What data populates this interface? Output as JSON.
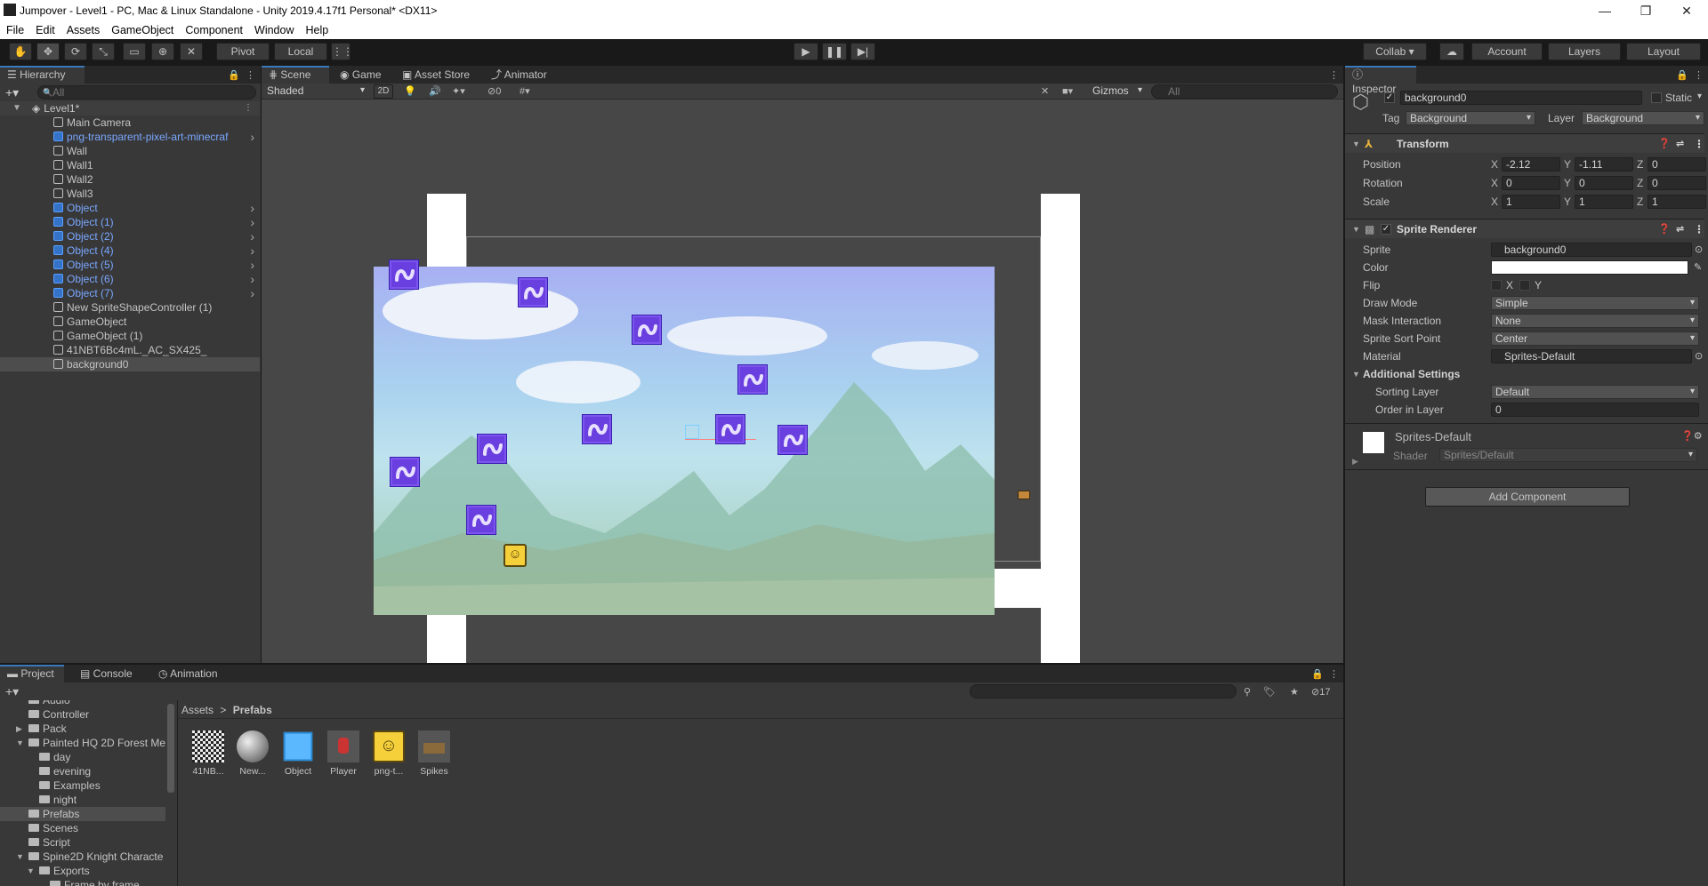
{
  "window": {
    "title": "Jumpover - Level1 - PC, Mac & Linux Standalone - Unity 2019.4.17f1 Personal* <DX11>",
    "minimize": "—",
    "maximize": "❐",
    "close": "✕"
  },
  "menu": [
    "File",
    "Edit",
    "Assets",
    "GameObject",
    "Component",
    "Window",
    "Help"
  ],
  "toolbar": {
    "pivot_label": "Pivot",
    "local_label": "Local",
    "collab_label": "Collab ▾",
    "account_label": "Account",
    "layers_label": "Layers",
    "layout_label": "Layout"
  },
  "hierarchy": {
    "tab_label": "Hierarchy",
    "search_placeholder": "All",
    "scene_name": "Level1*",
    "items": [
      {
        "label": "Main Camera",
        "blue": false,
        "children": false
      },
      {
        "label": "png-transparent-pixel-art-minecraf",
        "blue": true,
        "children": true
      },
      {
        "label": "Wall",
        "blue": false,
        "children": false
      },
      {
        "label": "Wall1",
        "blue": false,
        "children": false
      },
      {
        "label": "Wall2",
        "blue": false,
        "children": false
      },
      {
        "label": "Wall3",
        "blue": false,
        "children": false
      },
      {
        "label": "Object",
        "blue": true,
        "children": true
      },
      {
        "label": "Object (1)",
        "blue": true,
        "children": true
      },
      {
        "label": "Object (2)",
        "blue": true,
        "children": true
      },
      {
        "label": "Object (4)",
        "blue": true,
        "children": true
      },
      {
        "label": "Object (5)",
        "blue": true,
        "children": true
      },
      {
        "label": "Object (6)",
        "blue": true,
        "children": true
      },
      {
        "label": "Object (7)",
        "blue": true,
        "children": true
      },
      {
        "label": "New SpriteShapeController (1)",
        "blue": false,
        "children": false
      },
      {
        "label": "GameObject",
        "blue": false,
        "children": false
      },
      {
        "label": "GameObject (1)",
        "blue": false,
        "children": false
      },
      {
        "label": "41NBT6Bc4mL._AC_SX425_",
        "blue": false,
        "children": false
      },
      {
        "label": "background0",
        "blue": false,
        "children": false,
        "selected": true
      }
    ]
  },
  "scene_tabs": [
    "Scene",
    "Game",
    "Asset Store",
    "Animator"
  ],
  "scene_toolbar": {
    "shading": "Shaded",
    "mode_2d": "2D",
    "hidden_count": "0",
    "gizmos": "Gizmos",
    "search_placeholder": "All"
  },
  "inspector": {
    "tab_label": "Inspector",
    "object_name": "background0",
    "static_label": "Static",
    "tag_label": "Tag",
    "tag_value": "Background",
    "layer_label": "Layer",
    "layer_value": "Background",
    "transform": {
      "title": "Transform",
      "position_label": "Position",
      "rotation_label": "Rotation",
      "scale_label": "Scale",
      "position": {
        "x": "-2.12",
        "y": "-1.11",
        "z": "0"
      },
      "rotation": {
        "x": "0",
        "y": "0",
        "z": "0"
      },
      "scale": {
        "x": "1",
        "y": "1",
        "z": "1"
      }
    },
    "sprite_renderer": {
      "title": "Sprite Renderer",
      "sprite_label": "Sprite",
      "sprite_value": "background0",
      "color_label": "Color",
      "flip_label": "Flip",
      "flip_x": "X",
      "flip_y": "Y",
      "draw_mode_label": "Draw Mode",
      "draw_mode_value": "Simple",
      "mask_label": "Mask Interaction",
      "mask_value": "None",
      "sort_point_label": "Sprite Sort Point",
      "sort_point_value": "Center",
      "material_label": "Material",
      "material_value": "Sprites-Default",
      "additional_label": "Additional Settings",
      "sorting_layer_label": "Sorting Layer",
      "sorting_layer_value": "Default",
      "order_label": "Order in Layer",
      "order_value": "0"
    },
    "material": {
      "name": "Sprites-Default",
      "shader_label": "Shader",
      "shader_value": "Sprites/Default"
    },
    "add_component": "Add Component"
  },
  "bottom_tabs": [
    "Project",
    "Console",
    "Animation"
  ],
  "project": {
    "hidden_count": "17",
    "breadcrumb_root": "Assets",
    "breadcrumb_sep": ">",
    "breadcrumb_current": "Prefabs",
    "tree": [
      {
        "label": "Audio",
        "indent": 1,
        "arrow": ""
      },
      {
        "label": "Controller",
        "indent": 1,
        "arrow": ""
      },
      {
        "label": "Pack",
        "indent": 1,
        "arrow": "▶"
      },
      {
        "label": "Painted HQ 2D Forest Me",
        "indent": 1,
        "arrow": "▼"
      },
      {
        "label": "day",
        "indent": 2,
        "arrow": ""
      },
      {
        "label": "evening",
        "indent": 2,
        "arrow": ""
      },
      {
        "label": "Examples",
        "indent": 2,
        "arrow": ""
      },
      {
        "label": "night",
        "indent": 2,
        "arrow": ""
      },
      {
        "label": "Prefabs",
        "indent": 1,
        "arrow": "",
        "selected": true
      },
      {
        "label": "Scenes",
        "indent": 1,
        "arrow": ""
      },
      {
        "label": "Script",
        "indent": 1,
        "arrow": ""
      },
      {
        "label": "Spine2D Knight Characte",
        "indent": 1,
        "arrow": "▼"
      },
      {
        "label": "Exports",
        "indent": 2,
        "arrow": "▼"
      },
      {
        "label": "Frame by frame",
        "indent": 3,
        "arrow": ""
      }
    ],
    "assets": [
      "41NB...",
      "New...",
      "Object",
      "Player",
      "png-t...",
      "Spikes"
    ]
  }
}
